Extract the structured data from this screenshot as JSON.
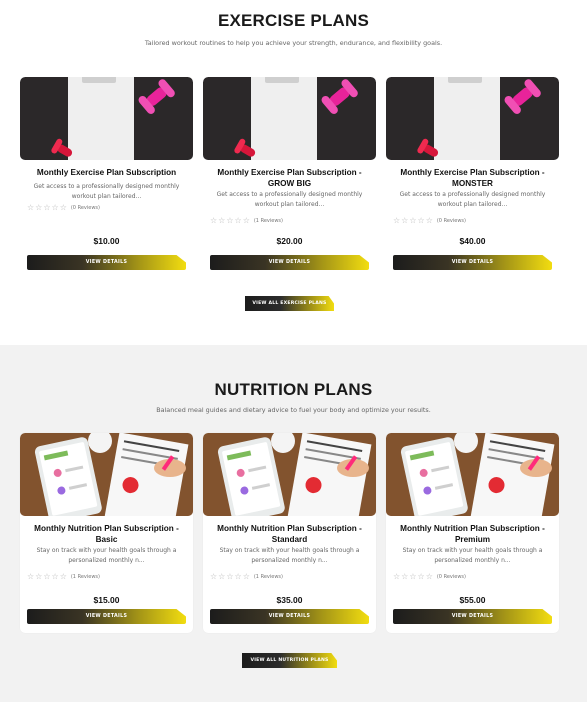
{
  "exercise": {
    "title": "EXERCISE PLANS",
    "subtitle": "Tailored workout routines to help you achieve your strength, endurance, and flexibility goals.",
    "view_all_label": "VIEW ALL EXERCISE PLANS",
    "products": [
      {
        "title": "Monthly Exercise Plan Subscription",
        "desc": "Get access to a professionally designed monthly workout plan tailored...",
        "reviews": "(0 Reviews)",
        "price": "$10.00",
        "button": "VIEW DETAILS",
        "image_icon": "dumbbell-clipboard-image"
      },
      {
        "title": "Monthly Exercise Plan Subscription - GROW BIG",
        "desc": "Get access to a professionally designed monthly workout plan tailored...",
        "reviews": "(1 Reviews)",
        "price": "$20.00",
        "button": "VIEW DETAILS",
        "image_icon": "dumbbell-clipboard-image"
      },
      {
        "title": "Monthly Exercise Plan Subscription - MONSTER",
        "desc": "Get access to a professionally designed monthly workout plan tailored...",
        "reviews": "(0 Reviews)",
        "price": "$40.00",
        "button": "VIEW DETAILS",
        "image_icon": "dumbbell-clipboard-image"
      }
    ]
  },
  "nutrition": {
    "title": "NUTRITION PLANS",
    "subtitle": "Balanced meal guides and dietary advice to fuel your body and optimize your results.",
    "view_all_label": "VIEW ALL NUTRITION PLANS",
    "products": [
      {
        "title": "Monthly Nutrition Plan Subscription - Basic",
        "desc": "Stay on track with your health goals through a personalized monthly n...",
        "reviews": "(1 Reviews)",
        "price": "$15.00",
        "button": "VIEW DETAILS",
        "image_icon": "meal-planner-image"
      },
      {
        "title": "Monthly Nutrition Plan Subscription - Standard",
        "desc": "Stay on track with your health goals through a personalized monthly n...",
        "reviews": "(1 Reviews)",
        "price": "$35.00",
        "button": "VIEW DETAILS",
        "image_icon": "meal-planner-image"
      },
      {
        "title": "Monthly Nutrition Plan Subscription - Premium",
        "desc": "Stay on track with your health goals through a personalized monthly n...",
        "reviews": "(0 Reviews)",
        "price": "$55.00",
        "button": "VIEW DETAILS",
        "image_icon": "meal-planner-image"
      }
    ]
  },
  "rating_stars": "☆☆☆☆☆",
  "colors": {
    "accent_yellow": "#f2dd10",
    "dark": "#1c1c1c",
    "dumbbell_pink": "#e8239a"
  }
}
